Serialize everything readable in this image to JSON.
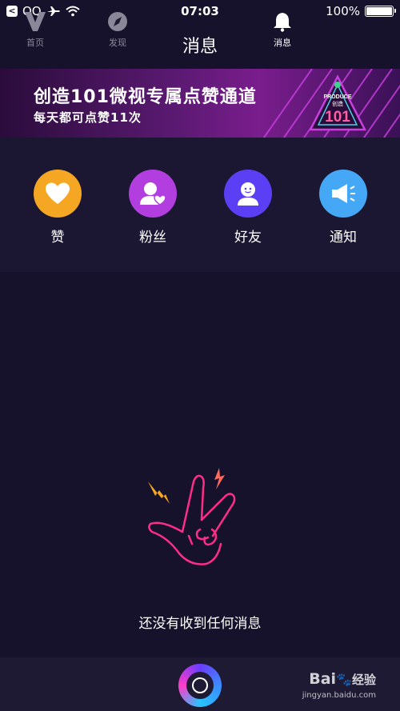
{
  "status": {
    "app": "QQ",
    "time": "07:03",
    "battery": "100%"
  },
  "header": {
    "title": "消息"
  },
  "banner": {
    "title": "创造101微视专属点赞通道",
    "subtitle": "每天都可点赞11次",
    "logo_top": "PRODUCE",
    "logo_cn": "创造",
    "logo_num": "101"
  },
  "categories": [
    {
      "label": "赞",
      "color": "#f5a623"
    },
    {
      "label": "粉丝",
      "color": "#b23ee0"
    },
    {
      "label": "好友",
      "color": "#5a3ff5"
    },
    {
      "label": "通知",
      "color": "#45a8f6"
    }
  ],
  "empty": {
    "text": "还没有收到任何消息"
  },
  "tabs": [
    {
      "label": "首页"
    },
    {
      "label": "发现"
    },
    {
      "label": "消息"
    }
  ],
  "watermark": {
    "brand": "Bai",
    "brand2": "经验",
    "url": "jingyan.baidu.com"
  }
}
